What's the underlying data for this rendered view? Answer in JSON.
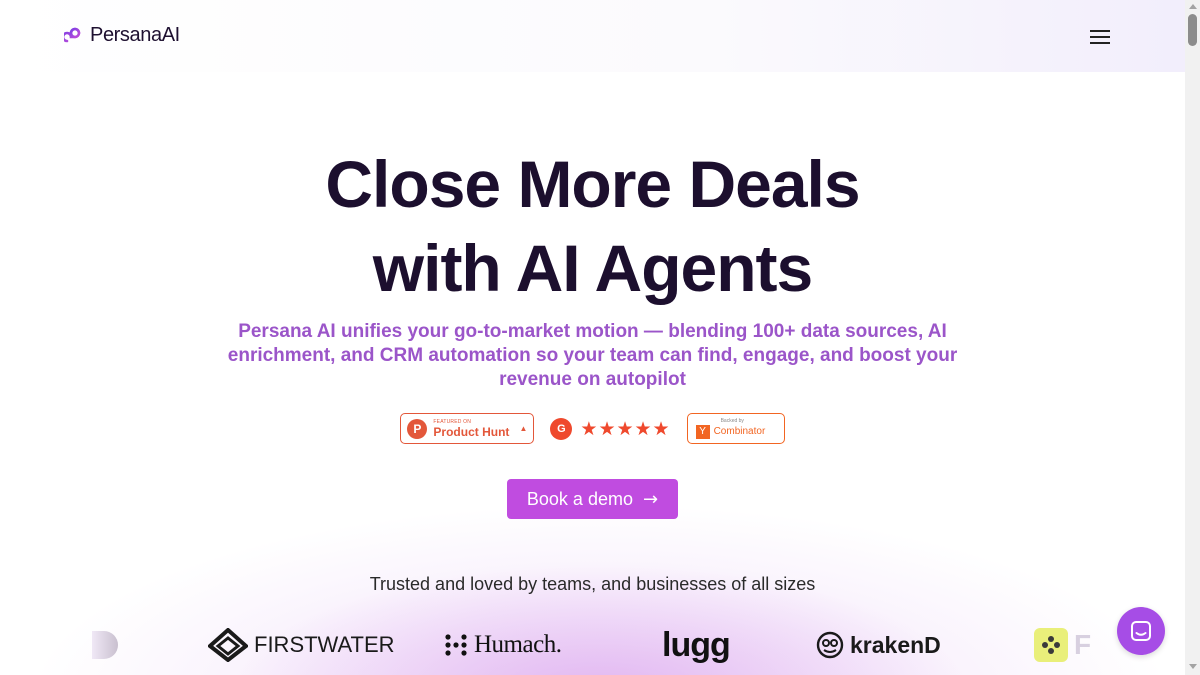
{
  "header": {
    "logo_text": "PersanaAI",
    "menu_icon": "hamburger-icon"
  },
  "hero": {
    "title_line1": "Close More Deals",
    "title_line2": "with AI Agents",
    "subtitle": "Persana AI unifies your go-to-market motion — blending 100+ data sources, AI enrichment, and CRM automation so your team can find, engage, and boost your revenue on autopilot"
  },
  "badges": {
    "product_hunt": {
      "small": "Featured on",
      "main": "Product Hunt",
      "letter": "P",
      "arrow": "▲"
    },
    "g2": {
      "letter": "G",
      "stars": "★★★★★",
      "rating": 5
    },
    "ycombinator": {
      "small": "Backed by",
      "letter": "Y",
      "main": "Combinator"
    }
  },
  "cta": {
    "label": "Book a demo",
    "arrow": "→"
  },
  "trusted": {
    "text": "Trusted and loved by teams, and businesses of all sizes",
    "logos": [
      "FIRSTWATER",
      "Humach.",
      "lugg",
      "krakenD",
      "F"
    ]
  },
  "colors": {
    "accent": "#c04ce0",
    "subtitle": "#9b55c9",
    "title": "#1c0f2e",
    "product_hunt": "#e3573a",
    "g2": "#ef492d",
    "ycombinator": "#f26522",
    "chat": "#a64de6"
  }
}
